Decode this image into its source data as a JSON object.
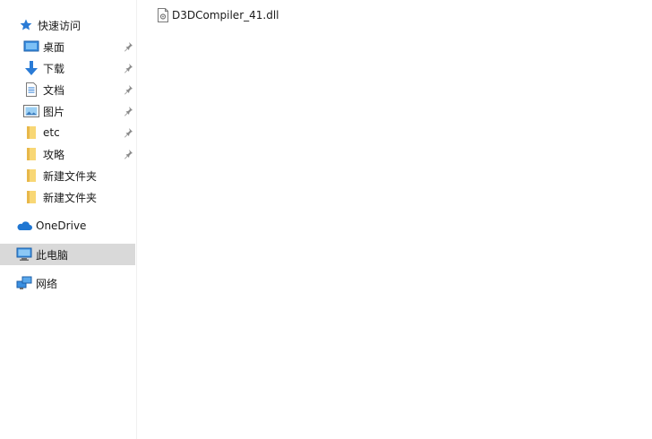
{
  "sidebar": {
    "quick_access": {
      "label": "快速访问",
      "icon": "star-icon"
    },
    "pinned": [
      {
        "label": "桌面",
        "icon": "desktop-icon",
        "pinned": true
      },
      {
        "label": "下载",
        "icon": "download-arrow-icon",
        "pinned": true
      },
      {
        "label": "文档",
        "icon": "document-icon",
        "pinned": true
      },
      {
        "label": "图片",
        "icon": "pictures-icon",
        "pinned": true
      },
      {
        "label": "etc",
        "icon": "folder-icon",
        "pinned": true
      },
      {
        "label": "攻略",
        "icon": "folder-icon",
        "pinned": true
      },
      {
        "label": "新建文件夹",
        "icon": "folder-icon",
        "pinned": false
      },
      {
        "label": "新建文件夹",
        "icon": "folder-icon",
        "pinned": false
      }
    ],
    "onedrive": {
      "label": "OneDrive",
      "icon": "cloud-icon"
    },
    "this_pc": {
      "label": "此电脑",
      "icon": "computer-icon",
      "selected": true
    },
    "network": {
      "label": "网络",
      "icon": "network-icon"
    }
  },
  "files": [
    {
      "name": "D3DCompiler_41.dll",
      "icon": "dll-file-icon"
    }
  ],
  "colors": {
    "selected_bg": "#d9d9d9",
    "folder_yellow": "#f8d775",
    "accent_blue": "#2a7bd6"
  }
}
